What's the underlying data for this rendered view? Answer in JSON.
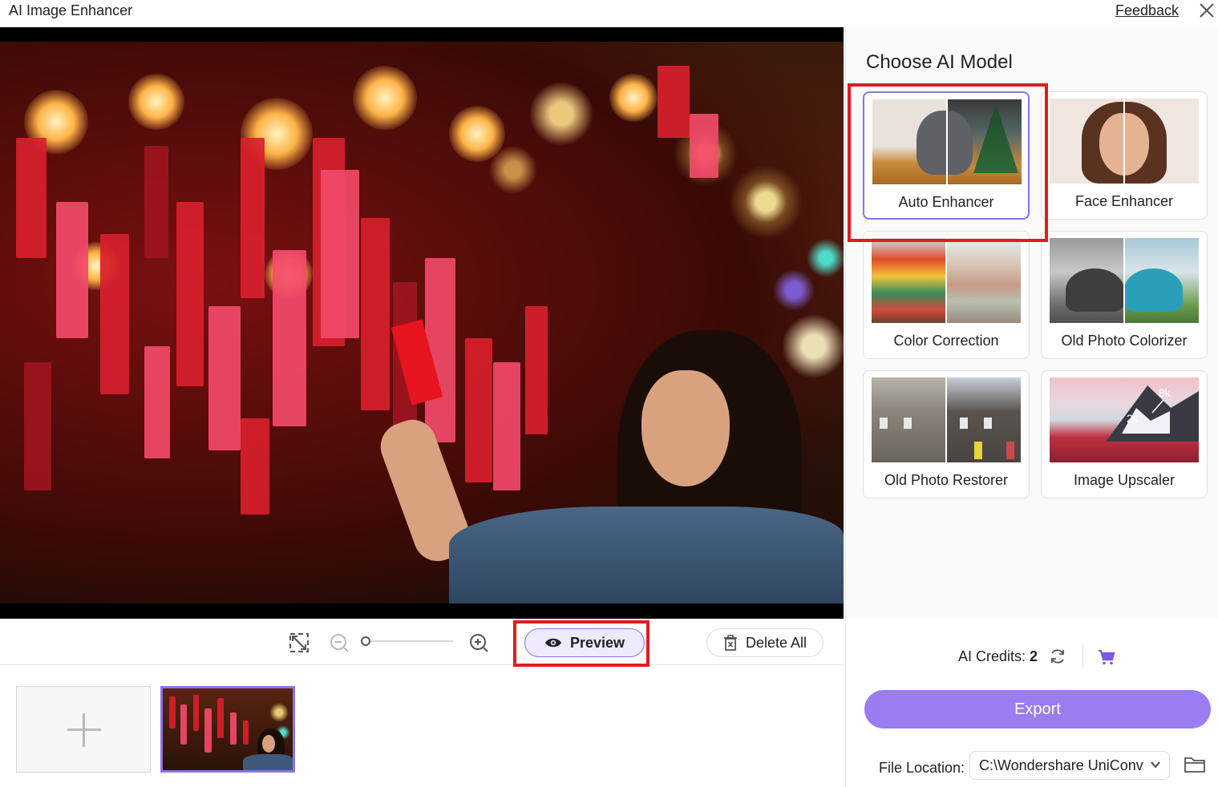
{
  "window": {
    "title": "AI Image Enhancer",
    "feedback_label": "Feedback"
  },
  "toolbar": {
    "preview_label": "Preview",
    "delete_all_label": "Delete All"
  },
  "side_panel": {
    "heading": "Choose AI Model",
    "models": [
      {
        "label": "Auto Enhancer",
        "selected": true
      },
      {
        "label": "Face Enhancer",
        "selected": false
      },
      {
        "label": "Color Correction",
        "selected": false
      },
      {
        "label": "Old Photo Colorizer",
        "selected": false
      },
      {
        "label": "Old Photo Restorer",
        "selected": false
      },
      {
        "label": "Image Upscaler",
        "selected": false
      }
    ],
    "upscaler_badges": [
      "8k",
      "2k"
    ],
    "credits_label": "AI Credits:",
    "credits_value": "2",
    "export_label": "Export",
    "file_location_label": "File Location:",
    "file_location_value": "C:\\Wondershare UniConv"
  },
  "colors": {
    "accent": "#9b7cf1",
    "accent_border": "#8a73e8",
    "highlight_red": "#e01b22"
  }
}
